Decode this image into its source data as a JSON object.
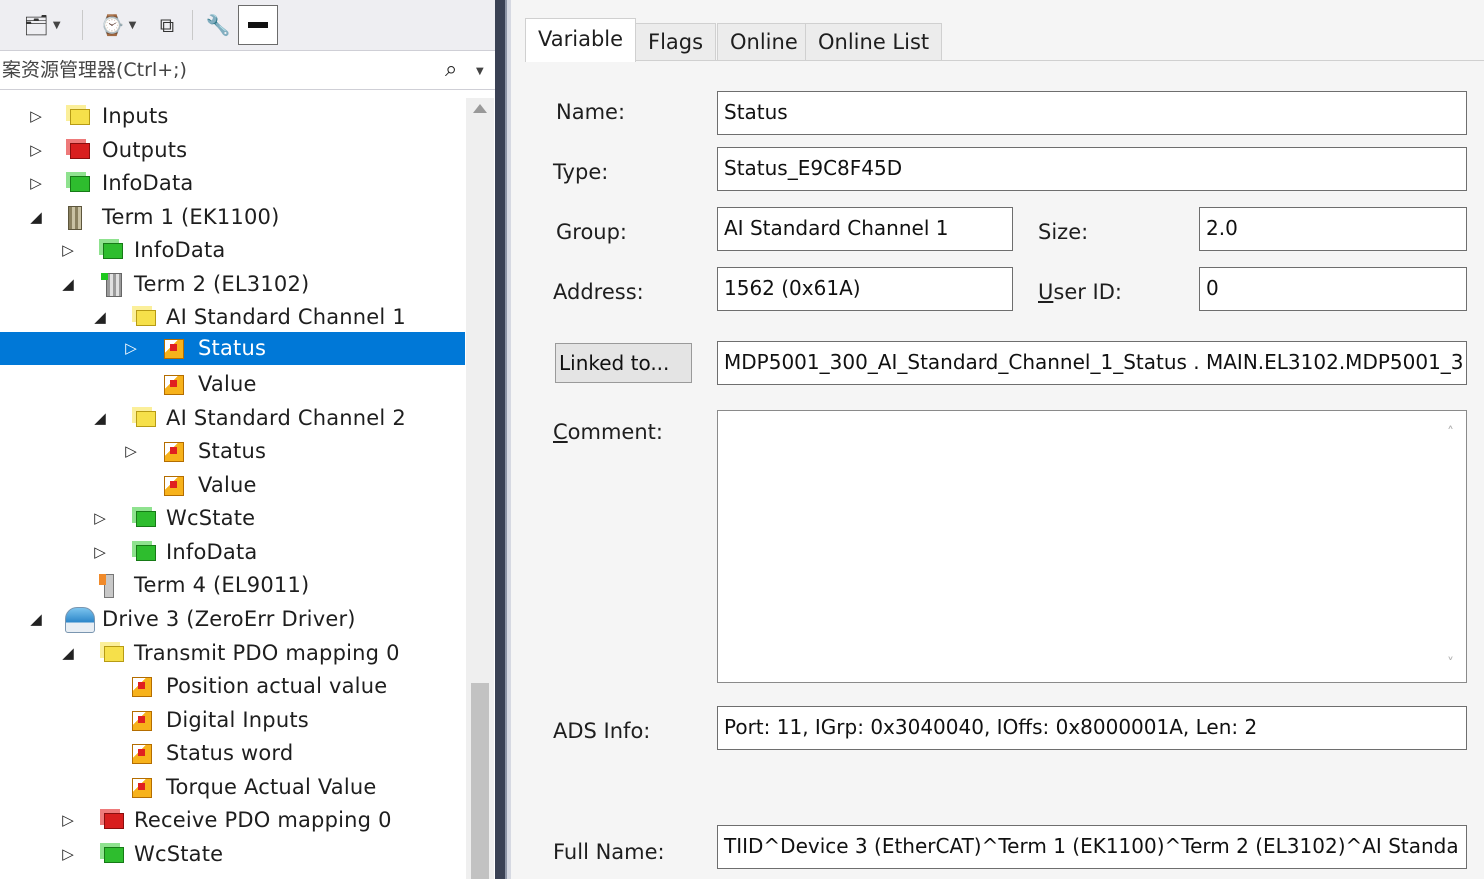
{
  "toolbar": {
    "buttons": [
      "sync-icon",
      "clock-icon",
      "windows-icon",
      "wrench-icon",
      "pin-icon"
    ]
  },
  "search": {
    "placeholder": "案资源管理器(Ctrl+;)"
  },
  "tree": {
    "items": [
      {
        "label": "Inputs"
      },
      {
        "label": "Outputs"
      },
      {
        "label": "InfoData"
      },
      {
        "label": "Term 1 (EK1100)"
      },
      {
        "label": "InfoData"
      },
      {
        "label": "Term 2 (EL3102)"
      },
      {
        "label": "AI Standard Channel 1"
      },
      {
        "label": "Status"
      },
      {
        "label": "Value"
      },
      {
        "label": "AI Standard Channel 2"
      },
      {
        "label": "Status"
      },
      {
        "label": "Value"
      },
      {
        "label": "WcState"
      },
      {
        "label": "InfoData"
      },
      {
        "label": "Term 4 (EL9011)"
      },
      {
        "label": "Drive 3 (ZeroErr Driver)"
      },
      {
        "label": "Transmit PDO mapping 0"
      },
      {
        "label": "Position actual value"
      },
      {
        "label": "Digital Inputs"
      },
      {
        "label": "Status word"
      },
      {
        "label": "Torque Actual Value"
      },
      {
        "label": "Receive PDO mapping 0"
      },
      {
        "label": "WcState"
      }
    ],
    "selected_label": "Status"
  },
  "tabs": [
    {
      "label": "Variable"
    },
    {
      "label": "Flags"
    },
    {
      "label": "Online"
    },
    {
      "label": "Online List"
    }
  ],
  "form": {
    "name_label": "Name:",
    "name_value": "Status",
    "type_label": "Type:",
    "type_value": "Status_E9C8F45D",
    "group_label": "Group:",
    "group_value": "AI Standard Channel 1",
    "size_label": "Size:",
    "size_value": "2.0",
    "address_label": "Address:",
    "address_value": "1562 (0x61A)",
    "userid_label_u": "U",
    "userid_label_rest": "ser ID:",
    "userid_value": "0",
    "linked_button": "Linked to...",
    "linked_value": "MDP5001_300_AI_Standard_Channel_1_Status . MAIN.EL3102.MDP5001_3",
    "comment_label_u": "C",
    "comment_label_rest": "omment:",
    "comment_value": "",
    "adsinfo_label": "ADS Info:",
    "adsinfo_value": "Port: 11, IGrp: 0x3040040, IOffs: 0x8000001A, Len: 2",
    "fullname_label": "Full Name:",
    "fullname_value": "TIID^Device 3 (EtherCAT)^Term 1 (EK1100)^Term 2 (EL3102)^AI Standa"
  }
}
